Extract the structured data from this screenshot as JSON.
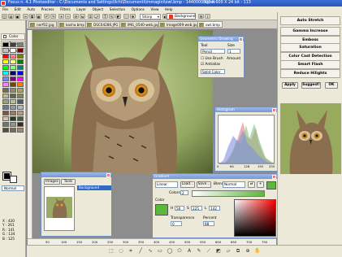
{
  "window": {
    "title": "Focus n. 4.1 Photoeditor - C:\\Documents and Settings\\Ilchi\\Documenti\\immagini\\owl.bmp - 1440000 bytes",
    "image_info": "800 X 600 X 24 bit - 113"
  },
  "menu": [
    "File",
    "Edit",
    "Auto",
    "Process",
    "Filters",
    "Layer",
    "Object",
    "Selection",
    "Options",
    "View",
    "Help"
  ],
  "toolbar": {
    "tool_select": "Sharp",
    "background_label": "Background",
    "background_color": "#e03a2a"
  },
  "left_panel": {
    "tabs": [
      "Color",
      "Texture",
      "Object"
    ],
    "palette": [
      "#000000",
      "#404040",
      "#808080",
      "#c0c0c0",
      "#ffffff",
      "#800000",
      "#ff0000",
      "#ff8080",
      "#808000",
      "#ffff00",
      "#ffff80",
      "#008000",
      "#00ff00",
      "#80ff80",
      "#008080",
      "#00ffff",
      "#000080",
      "#0000ff",
      "#8080ff",
      "#800080",
      "#ff00ff",
      "#ff80ff",
      "#804000",
      "#ff8000",
      "#6f6a50",
      "#8f8a60",
      "#a9a070",
      "#c0b890",
      "#5a6a4a",
      "#7a8a5a",
      "#9aa07a",
      "#b8c098",
      "#4a5a6a",
      "#6a7a8a",
      "#8a9aaa",
      "#aab8c8",
      "#7a5a4a",
      "#9a7a6a",
      "#b89a8a",
      "#d8c0b0",
      "#2a3a2a",
      "#4a5a4a",
      "#6a7a6a",
      "#8a9a8a",
      "#3a2a1a",
      "#5a4a3a",
      "#7a6a5a",
      "#9a8a7a"
    ],
    "foreground_color": "#000000",
    "background_color": "#ffffff",
    "blend_mode": "Normal",
    "coords": [
      "X : 420",
      "Y : 261",
      "R : 141",
      "G : 134",
      "B : 125"
    ]
  },
  "file_tabs": [
    "nerf02.jpg",
    "kasha.bmp",
    "DSC04286.JPG",
    "IMG_0540-web.jpg",
    "Image009-web.jpg",
    "owl.bmp"
  ],
  "active_file_tab": 5,
  "geometric_drawing": {
    "title": "Geometric Drawing",
    "tool_label": "Tool",
    "tool_value": "Pencil",
    "size_label": "Size",
    "size_value": "1",
    "use_brush": "Use Brush",
    "amount_label": "Amount",
    "antialias": "Antialias",
    "color_mode": "Solid Color"
  },
  "histogram": {
    "title": "Histogram",
    "axis_ticks": [
      "0",
      "64",
      "128",
      "192",
      "255"
    ]
  },
  "layers": {
    "tabs": [
      "Images",
      "Tools"
    ],
    "layer_name": "Background",
    "blend": "Normal"
  },
  "gradient": {
    "title": "Gradient",
    "type": "Linear",
    "load": "Load...",
    "save": "Save...",
    "blend_label": "Blend",
    "blend_value": "Normal",
    "colors_label": "Colors",
    "colors_value": "2",
    "color_section": "Color",
    "h_label": "H",
    "h_value": "50",
    "s_label": "S",
    "s_value": "225",
    "l_label": "L",
    "l_value": "142",
    "transparence_label": "Transparence",
    "transparence_value": "0",
    "percent_label": "Percent",
    "percent_value": "88",
    "swatch_color": "#5cb83a"
  },
  "right_panel": {
    "buttons": [
      "Auto Stretch",
      "Gamma Increase",
      "Emboss",
      "Saturation",
      "Color Cast Detection",
      "Smart Flash",
      "Reduce Hilights"
    ],
    "apply": "Apply",
    "suggest": "Suggest!",
    "ok": "OK"
  },
  "ruler": [
    "50",
    "100",
    "150",
    "200",
    "250",
    "300",
    "350",
    "400",
    "450",
    "500",
    "550",
    "600",
    "650",
    "700",
    "750"
  ]
}
